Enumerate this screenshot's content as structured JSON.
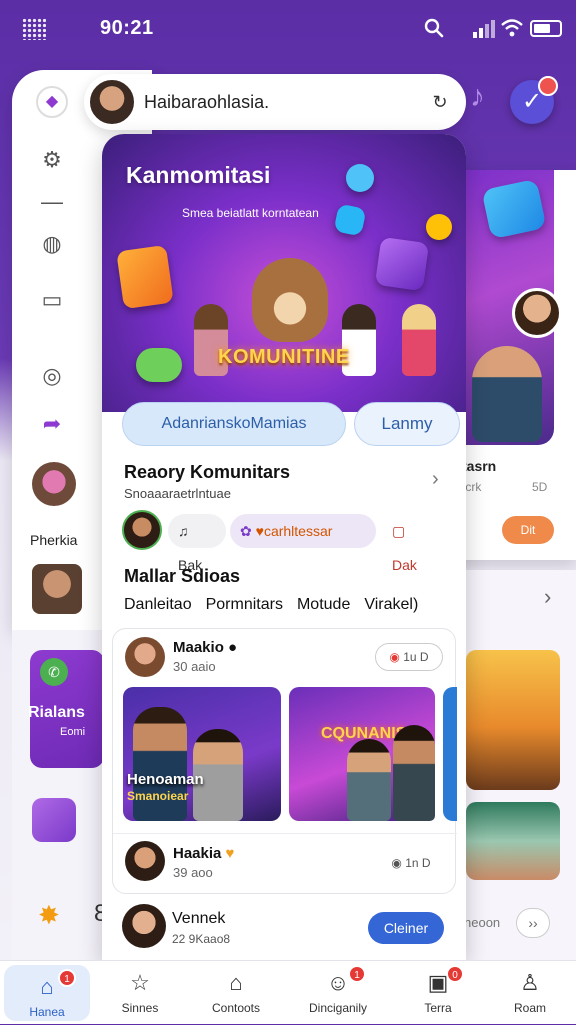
{
  "status_bar": {
    "time": "90:21"
  },
  "search": {
    "value": "Haibaraohlasia."
  },
  "hero": {
    "title": "Kanmomitasi",
    "subtitle": "Smea beiatlatt korntatean",
    "banner": "KOMUNITINE"
  },
  "pills": {
    "primary": "AdanrianskoMamias",
    "secondary": "Lanmy"
  },
  "section1": {
    "title": "Reaory Komunitars",
    "subtitle": "Snoaaaraetrlntuae",
    "chips": [
      "Bak",
      "carhltessar",
      "Dak"
    ]
  },
  "section2": {
    "title": "Mallar Sdioas",
    "tabs": [
      "Danleitao",
      "Pormnitars",
      "Motude",
      "Virakel)"
    ]
  },
  "post1": {
    "name": "Maakio",
    "time": "30 aaio",
    "button": "1u D",
    "caption1": "Henoaman",
    "caption2": "Smanoiear",
    "caption3": "CQUNANIS"
  },
  "post2": {
    "name": "Haakia",
    "time": "39 aoo",
    "button": "1n D"
  },
  "post3": {
    "name": "Vennek",
    "time": "22 9Kaao8",
    "button": "Cleiner"
  },
  "side_left": {
    "name": "Pherkia",
    "card_text": "Rialans",
    "card_sub": "Eomi",
    "number": "8"
  },
  "side_right": {
    "label": "tasrn",
    "sub1": "tcrk",
    "sub2": "5D",
    "button": "Dit",
    "bottom_text": "neoon"
  },
  "nav": [
    {
      "label": "Hanea",
      "icon": "home-icon",
      "badge": "1"
    },
    {
      "label": "Sinnes",
      "icon": "star-icon",
      "badge": ""
    },
    {
      "label": "Contoots",
      "icon": "house-outline-icon",
      "badge": ""
    },
    {
      "label": "Dinciganily",
      "icon": "face-icon",
      "badge": "1"
    },
    {
      "label": "Terra",
      "icon": "camera-icon",
      "badge": "0"
    },
    {
      "label": "Roam",
      "icon": "user-icon",
      "badge": ""
    }
  ],
  "colors": {
    "accent": "#3566d6",
    "brand": "#7a2fc9",
    "alert": "#e53935"
  }
}
